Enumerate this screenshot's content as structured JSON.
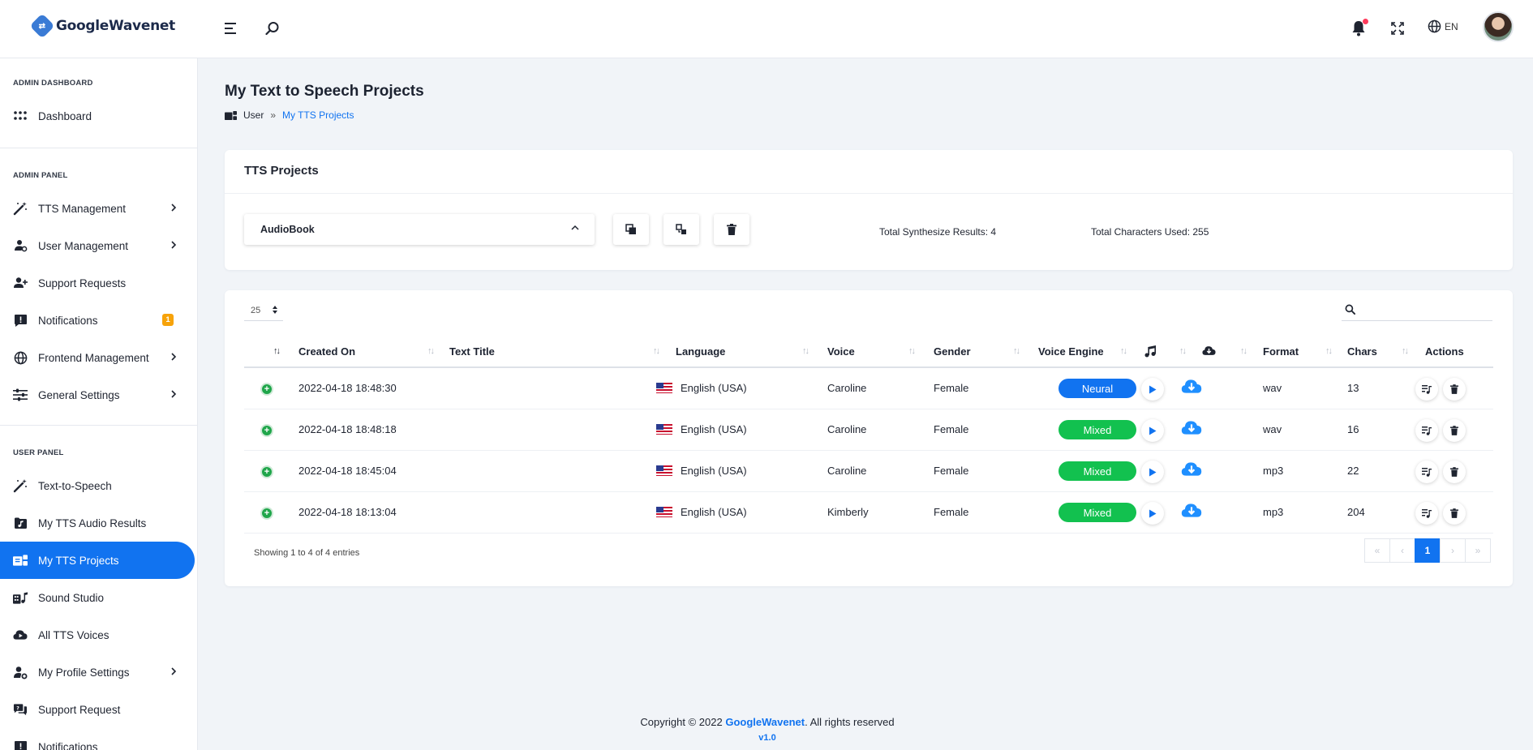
{
  "app": {
    "logo_mark": "⇄",
    "name": "GoogleWavenet"
  },
  "topbar": {
    "language": "EN",
    "icons": [
      "menu-icon",
      "search-icon",
      "bell-icon",
      "fullscreen-icon",
      "globe-icon"
    ]
  },
  "sidebar": {
    "sections": [
      "ADMIN DASHBOARD",
      "ADMIN PANEL",
      "USER PANEL"
    ],
    "items": [
      {
        "label": "Dashboard",
        "icon": "grid-icon"
      },
      {
        "label": "TTS Management",
        "icon": "magic-wand-icon"
      },
      {
        "label": "User Management",
        "icon": "users-cog-icon"
      },
      {
        "label": "Support Requests",
        "icon": "user-plus-icon"
      },
      {
        "label": "Notifications",
        "icon": "comment-alert-icon",
        "badge": "1"
      },
      {
        "label": "Frontend Management",
        "icon": "globe-icon"
      },
      {
        "label": "General Settings",
        "icon": "sliders-icon"
      },
      {
        "label": "Text-to-Speech",
        "icon": "magic-wand-icon"
      },
      {
        "label": "My TTS Audio Results",
        "icon": "music-folder-icon"
      },
      {
        "label": "My TTS Projects",
        "icon": "projects-icon",
        "active": true
      },
      {
        "label": "Sound Studio",
        "icon": "studio-icon"
      },
      {
        "label": "All TTS Voices",
        "icon": "cloud-play-icon"
      },
      {
        "label": "My Profile Settings",
        "icon": "user-cog-icon"
      },
      {
        "label": "Support Request",
        "icon": "comments-icon"
      },
      {
        "label": "Notifications",
        "icon": "comment-alert-icon"
      }
    ]
  },
  "page": {
    "title": "My Text to Speech Projects",
    "breadcrumb": [
      "User",
      "»",
      "My TTS Projects"
    ]
  },
  "projects_card": {
    "title": "TTS Projects",
    "selected_project": "AudioBook",
    "buttons": [
      "copy-icon",
      "merge-icon",
      "trash-icon"
    ],
    "total_results": "Total Synthesize Results: 4",
    "total_chars": "Total Characters Used: 255"
  },
  "table": {
    "page_length": "25",
    "search_placeholder": "",
    "columns": [
      "Created On",
      "Text Title",
      "Language",
      "Voice",
      "Gender",
      "Voice Engine",
      "Format",
      "Chars",
      "Actions"
    ],
    "rows": [
      {
        "created": "2022-04-18 18:48:30",
        "title": "",
        "language": "English (USA)",
        "voice": "Caroline",
        "gender": "Female",
        "engine": "Neural",
        "format": "wav",
        "chars": "13"
      },
      {
        "created": "2022-04-18 18:48:18",
        "title": "",
        "language": "English (USA)",
        "voice": "Caroline",
        "gender": "Female",
        "engine": "Mixed",
        "format": "wav",
        "chars": "16"
      },
      {
        "created": "2022-04-18 18:45:04",
        "title": "",
        "language": "English (USA)",
        "voice": "Caroline",
        "gender": "Female",
        "engine": "Mixed",
        "format": "mp3",
        "chars": "22"
      },
      {
        "created": "2022-04-18 18:13:04",
        "title": "",
        "language": "English (USA)",
        "voice": "Kimberly",
        "gender": "Female",
        "engine": "Mixed",
        "format": "mp3",
        "chars": "204"
      }
    ],
    "engine_colors": {
      "Neural": "#1173f0",
      "Mixed": "#12c14f"
    },
    "showing": "Showing 1 to 4 of 4 entries",
    "pager": [
      "«",
      "‹",
      "1",
      "›",
      "»"
    ]
  },
  "footer": {
    "copyright": "Copyright © 2022",
    "brand": "GoogleWavenet",
    "rights": ". All rights reserved",
    "version": "v1.0"
  }
}
